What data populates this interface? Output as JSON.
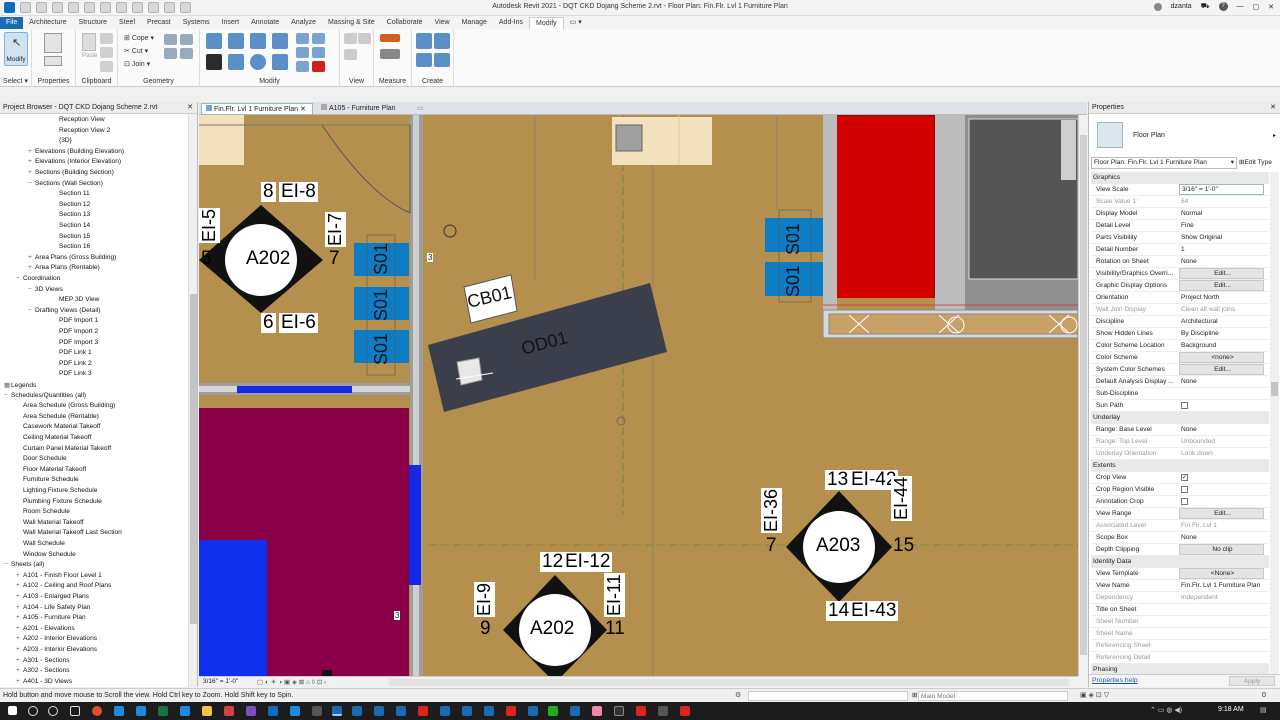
{
  "app_title": "Autodesk Revit 2021 - DQT CKD Dojang Scheme 2.rvt - Floor Plan: Fin.Flr. Lvl 1 Furniture Plan",
  "user": "dzanta",
  "menu_tabs": [
    "File",
    "Architecture",
    "Structure",
    "Steel",
    "Precast",
    "Systems",
    "Insert",
    "Annotate",
    "Analyze",
    "Massing & Site",
    "Collaborate",
    "View",
    "Manage",
    "Add-Ins",
    "Modify"
  ],
  "ribbon": {
    "select_button": "Modify",
    "select_panel": "Select",
    "properties_panel": "Properties",
    "clipboard_panel": "Clipboard",
    "paste_button": "Paste",
    "cope_label": "Cope",
    "cut_label": "Cut",
    "join_label": "Join",
    "geometry_panel": "Geometry",
    "modify_panel": "Modify",
    "view_panel": "View",
    "measure_panel": "Measure",
    "create_panel": "Create"
  },
  "project_browser": {
    "title": "Project Browser - DQT CKD Dojang Scheme 2.rvt",
    "items": [
      {
        "label": "Reception View",
        "indent": 4,
        "toggle": ""
      },
      {
        "label": "Reception View 2",
        "indent": 4,
        "toggle": ""
      },
      {
        "label": "{3D}",
        "indent": 4,
        "toggle": ""
      },
      {
        "label": "Elevations (Building Elevation)",
        "indent": 2,
        "toggle": "+"
      },
      {
        "label": "Elevations (Interior Elevation)",
        "indent": 2,
        "toggle": "+"
      },
      {
        "label": "Sections (Building Section)",
        "indent": 2,
        "toggle": "+"
      },
      {
        "label": "Sections (Wall Section)",
        "indent": 2,
        "toggle": "−"
      },
      {
        "label": "Section 11",
        "indent": 4,
        "toggle": ""
      },
      {
        "label": "Section 12",
        "indent": 4,
        "toggle": ""
      },
      {
        "label": "Section 13",
        "indent": 4,
        "toggle": ""
      },
      {
        "label": "Section 14",
        "indent": 4,
        "toggle": ""
      },
      {
        "label": "Section 15",
        "indent": 4,
        "toggle": ""
      },
      {
        "label": "Section 16",
        "indent": 4,
        "toggle": ""
      },
      {
        "label": "Area Plans (Gross Building)",
        "indent": 2,
        "toggle": "+"
      },
      {
        "label": "Area Plans (Rentable)",
        "indent": 2,
        "toggle": "+"
      },
      {
        "label": "Coordination",
        "indent": 1,
        "toggle": "−"
      },
      {
        "label": "3D Views",
        "indent": 2,
        "toggle": "−"
      },
      {
        "label": "MEP 3D View",
        "indent": 4,
        "toggle": ""
      },
      {
        "label": "Drafting Views (Detail)",
        "indent": 2,
        "toggle": "−"
      },
      {
        "label": "PDF Import 1",
        "indent": 4,
        "toggle": ""
      },
      {
        "label": "PDF Import 2",
        "indent": 4,
        "toggle": ""
      },
      {
        "label": "PDF Import 3",
        "indent": 4,
        "toggle": ""
      },
      {
        "label": "PDF Link 1",
        "indent": 4,
        "toggle": ""
      },
      {
        "label": "PDF Link 2",
        "indent": 4,
        "toggle": ""
      },
      {
        "label": "PDF Link 3",
        "indent": 4,
        "toggle": ""
      },
      {
        "label": "Legends",
        "indent": 0,
        "toggle": "▦"
      },
      {
        "label": "Schedules/Quantities (all)",
        "indent": 0,
        "toggle": "−"
      },
      {
        "label": "Area Schedule (Gross Building)",
        "indent": 1,
        "toggle": ""
      },
      {
        "label": "Area Schedule (Rentable)",
        "indent": 1,
        "toggle": ""
      },
      {
        "label": "Casework Material Takeoff",
        "indent": 1,
        "toggle": ""
      },
      {
        "label": "Ceiling Material Takeoff",
        "indent": 1,
        "toggle": ""
      },
      {
        "label": "Curtain Panel Material Takeoff",
        "indent": 1,
        "toggle": ""
      },
      {
        "label": "Door Schedule",
        "indent": 1,
        "toggle": ""
      },
      {
        "label": "Floor Material Takeoff",
        "indent": 1,
        "toggle": ""
      },
      {
        "label": "Furniture Schedule",
        "indent": 1,
        "toggle": ""
      },
      {
        "label": "Lighting Fixture Schedule",
        "indent": 1,
        "toggle": ""
      },
      {
        "label": "Plumbing Fixture Schedule",
        "indent": 1,
        "toggle": ""
      },
      {
        "label": "Room Schedule",
        "indent": 1,
        "toggle": ""
      },
      {
        "label": "Wall Material Takeoff",
        "indent": 1,
        "toggle": ""
      },
      {
        "label": "Wall Material Takeoff Last Section",
        "indent": 1,
        "toggle": ""
      },
      {
        "label": "Wall Schedule",
        "indent": 1,
        "toggle": ""
      },
      {
        "label": "Window Schedule",
        "indent": 1,
        "toggle": ""
      },
      {
        "label": "Sheets (all)",
        "indent": 0,
        "toggle": "−"
      },
      {
        "label": "A101 - Finish Floor Level 1",
        "indent": 1,
        "toggle": "+"
      },
      {
        "label": "A102 - Ceiling and Roof Plans",
        "indent": 1,
        "toggle": "+"
      },
      {
        "label": "A103 - Enlarged Plans",
        "indent": 1,
        "toggle": "+"
      },
      {
        "label": "A104 - Life Safety Plan",
        "indent": 1,
        "toggle": "+"
      },
      {
        "label": "A105 - Furniture Plan",
        "indent": 1,
        "toggle": "+"
      },
      {
        "label": "A201 - Elevations",
        "indent": 1,
        "toggle": "+"
      },
      {
        "label": "A202 - Interior Elevations",
        "indent": 1,
        "toggle": "+"
      },
      {
        "label": "A203 - Interior Elevations",
        "indent": 1,
        "toggle": "+"
      },
      {
        "label": "A301 - Sections",
        "indent": 1,
        "toggle": "+"
      },
      {
        "label": "A302 - Sections",
        "indent": 1,
        "toggle": "+"
      },
      {
        "label": "A401 - 3D Views",
        "indent": 1,
        "toggle": "+"
      }
    ]
  },
  "doc_tabs": [
    "Fin.Flr. Lvl 1 Furniture Plan",
    "A105 - Furniture Plan"
  ],
  "canvas": {
    "scale_label": "3/16\" = 1'-0\"",
    "tags": {
      "e1_top": "8",
      "e1_top_ref": "EI-8",
      "e1_left_ref": "EI-5",
      "e1_left_num": "5",
      "e1_right_ref": "EI-7",
      "e1_right_num": "7",
      "e1_bottom": "6",
      "e1_bottom_ref": "EI-6",
      "e1_sheet": "A202",
      "e2_top": "12",
      "e2_top_ref": "EI-12",
      "e2_left_ref": "EI-9",
      "e2_left_num": "9",
      "e2_right_ref": "EI-11",
      "e2_right_num": "11",
      "e2_sheet": "A202",
      "e3_top": "13",
      "e3_top_ref": "EI-42",
      "e3_left_ref": "EI-36",
      "e3_left_num": "7",
      "e3_right_ref": "EI-44",
      "e3_right_num": "15",
      "e3_bottom": "14",
      "e3_bottom_ref": "EI-43",
      "e3_sheet": "A203",
      "cb": "CB01",
      "od": "OD01",
      "s01": "S01",
      "door_num": "3"
    }
  },
  "properties": {
    "title": "Properties",
    "type_name": "Floor Plan",
    "selector": "Floor Plan: Fin.Flr. Lvl 1 Furniture Plan",
    "edit_type": "Edit Type",
    "sections": [
      {
        "name": "Graphics",
        "rows": [
          {
            "k": "View Scale",
            "v": "3/16\" = 1'-0\"",
            "style": "box"
          },
          {
            "k": "Scale Value    1:",
            "v": "64",
            "style": "dim"
          },
          {
            "k": "Display Model",
            "v": "Normal",
            "style": ""
          },
          {
            "k": "Detail Level",
            "v": "Fine",
            "style": ""
          },
          {
            "k": "Parts Visibility",
            "v": "Show Original",
            "style": ""
          },
          {
            "k": "Detail Number",
            "v": "1",
            "style": ""
          },
          {
            "k": "Rotation on Sheet",
            "v": "None",
            "style": ""
          },
          {
            "k": "Visibility/Graphics Overri...",
            "v": "Edit...",
            "style": "btn"
          },
          {
            "k": "Graphic Display Options",
            "v": "Edit...",
            "style": "btn"
          },
          {
            "k": "Orientation",
            "v": "Project North",
            "style": ""
          },
          {
            "k": "Wall Join Display",
            "v": "Clean all wall joins",
            "style": "dim"
          },
          {
            "k": "Discipline",
            "v": "Architectural",
            "style": ""
          },
          {
            "k": "Show Hidden Lines",
            "v": "By Discipline",
            "style": ""
          },
          {
            "k": "Color Scheme Location",
            "v": "Background",
            "style": ""
          },
          {
            "k": "Color Scheme",
            "v": "<none>",
            "style": "btn"
          },
          {
            "k": "System Color Schemes",
            "v": "Edit...",
            "style": "btn"
          },
          {
            "k": "Default Analysis Display ...",
            "v": "None",
            "style": ""
          },
          {
            "k": "Sub-Discipline",
            "v": "",
            "style": ""
          },
          {
            "k": "Sun Path",
            "v": "",
            "style": "check"
          }
        ]
      },
      {
        "name": "Underlay",
        "rows": [
          {
            "k": "Range: Base Level",
            "v": "None",
            "style": ""
          },
          {
            "k": "Range: Top Level",
            "v": "Unbounded",
            "style": "dim"
          },
          {
            "k": "Underlay Orientation",
            "v": "Look down",
            "style": "dim"
          }
        ]
      },
      {
        "name": "Extents",
        "rows": [
          {
            "k": "Crop View",
            "v": "",
            "style": "checked"
          },
          {
            "k": "Crop Region Visible",
            "v": "",
            "style": "check"
          },
          {
            "k": "Annotation Crop",
            "v": "",
            "style": "check"
          },
          {
            "k": "View Range",
            "v": "Edit...",
            "style": "btn"
          },
          {
            "k": "Associated Level",
            "v": "Fin.Flr. Lvl 1",
            "style": "dim"
          },
          {
            "k": "Scope Box",
            "v": "None",
            "style": ""
          },
          {
            "k": "Depth Clipping",
            "v": "No clip",
            "style": "btn"
          }
        ]
      },
      {
        "name": "Identity Data",
        "rows": [
          {
            "k": "View Template",
            "v": "<None>",
            "style": "btn"
          },
          {
            "k": "View Name",
            "v": "Fin.Flr. Lvl 1 Furniture Plan",
            "style": ""
          },
          {
            "k": "Dependency",
            "v": "Independent",
            "style": "dim"
          },
          {
            "k": "Title on Sheet",
            "v": "",
            "style": ""
          },
          {
            "k": "Sheet Number",
            "v": "",
            "style": "dimk"
          },
          {
            "k": "Sheet Name",
            "v": "",
            "style": "dimk"
          },
          {
            "k": "Referencing Sheet",
            "v": "",
            "style": "dimk"
          },
          {
            "k": "Referencing Detail",
            "v": "",
            "style": "dimk"
          }
        ]
      },
      {
        "name": "Phasing",
        "rows": []
      }
    ],
    "help_link": "Properties help",
    "apply_button": "Apply"
  },
  "status": {
    "message": "Hold button and move mouse to Scroll the view. Hold Ctrl key to Zoom. Hold Shift key to Spin.",
    "model": "Main Model",
    "workset_count": "0"
  },
  "taskbar": {
    "time": "9:18 AM"
  },
  "colors": {
    "floor": "#b58f4d",
    "blue": "#0c7dc4",
    "magenta": "#8a0046",
    "red": "#d40000",
    "desk": "#3b3f4c",
    "file_tab": "#1a6bb4"
  }
}
